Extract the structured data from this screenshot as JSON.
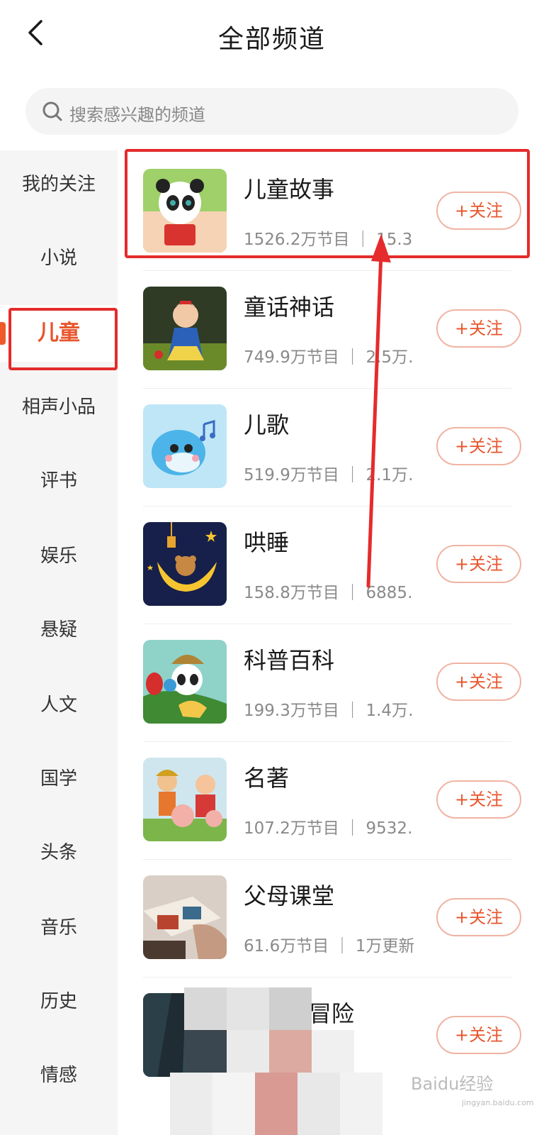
{
  "header": {
    "title": "全部频道",
    "back_icon": "chevron-left-icon"
  },
  "search": {
    "placeholder": "搜索感兴趣的频道",
    "icon": "search-icon"
  },
  "sidebar": {
    "active_index": 2,
    "items": [
      {
        "label": "我的关注"
      },
      {
        "label": "小说"
      },
      {
        "label": "儿童"
      },
      {
        "label": "相声小品"
      },
      {
        "label": "评书"
      },
      {
        "label": "娱乐"
      },
      {
        "label": "悬疑"
      },
      {
        "label": "人文"
      },
      {
        "label": "国学"
      },
      {
        "label": "头条"
      },
      {
        "label": "音乐"
      },
      {
        "label": "历史"
      },
      {
        "label": "情感"
      }
    ]
  },
  "channels": [
    {
      "name": "儿童故事",
      "stats": "1526.2万节目 ｜ 15.3…",
      "follow": "+关注"
    },
    {
      "name": "童话神话",
      "stats": "749.9万节目 ｜ 2.5万…",
      "follow": "+关注"
    },
    {
      "name": "儿歌",
      "stats": "519.9万节目 ｜ 2.1万…",
      "follow": "+关注"
    },
    {
      "name": "哄睡",
      "stats": "158.8万节目 ｜ 6885…",
      "follow": "+关注"
    },
    {
      "name": "科普百科",
      "stats": "199.3万节目 ｜ 1.4万…",
      "follow": "+关注"
    },
    {
      "name": "名著",
      "stats": "107.2万节目 ｜ 9532…",
      "follow": "+关注"
    },
    {
      "name": "父母课堂",
      "stats": "61.6万节目 ｜ 1万更新",
      "follow": "+关注"
    },
    {
      "name": "冒险",
      "stats": "",
      "follow": "+关注"
    }
  ],
  "colors": {
    "accent": "#e8562d",
    "annotation": "#e52b2b",
    "sidebar_bg": "#f5f5f5"
  },
  "watermark": {
    "text": "Baidu经验",
    "sub": "jingyan.baidu.com"
  }
}
